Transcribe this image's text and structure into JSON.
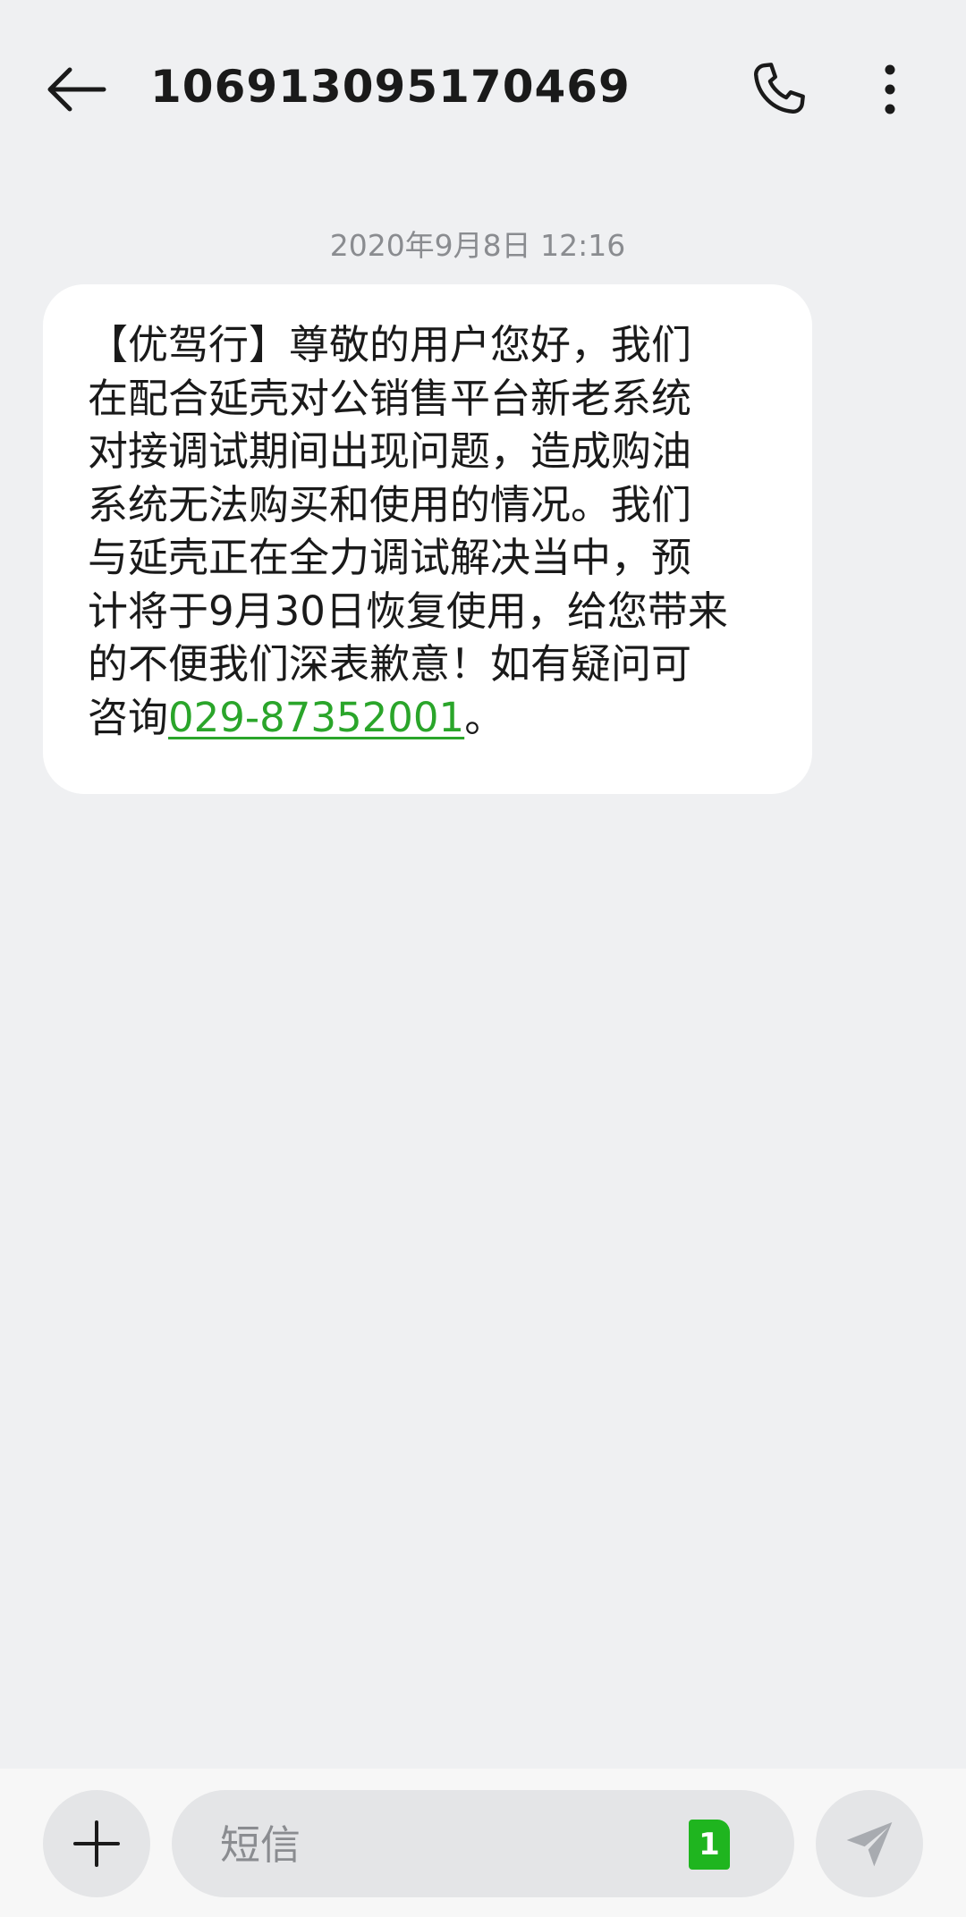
{
  "header": {
    "title": "106913095170469",
    "back_icon": "arrow-left-icon",
    "call_icon": "phone-icon",
    "more_icon": "more-vertical-icon"
  },
  "conversation": {
    "timestamp": "2020年9月8日 12:16",
    "messages": [
      {
        "lines": [
          "【优驾行】尊敬的用户您好，我们",
          "在配合延壳对公销售平台新老系统",
          "对接调试期间出现问题，造成购油",
          "系统无法购买和使用的情况。我们",
          "与延壳正在全力调试解决当中，预",
          "计将于9月30日恢复使用，给您带来",
          "的不便我们深表歉意！如有疑问可"
        ],
        "last_line_prefix": "咨询",
        "phone": "029-87352001",
        "last_line_suffix": "。"
      }
    ]
  },
  "composer": {
    "placeholder": "短信",
    "sim_label": "1",
    "add_icon": "plus-icon",
    "send_icon": "send-icon"
  },
  "colors": {
    "background": "#eff0f2",
    "bubble": "#ffffff",
    "link": "#2aa52a",
    "sim_badge": "#1fb51f"
  }
}
